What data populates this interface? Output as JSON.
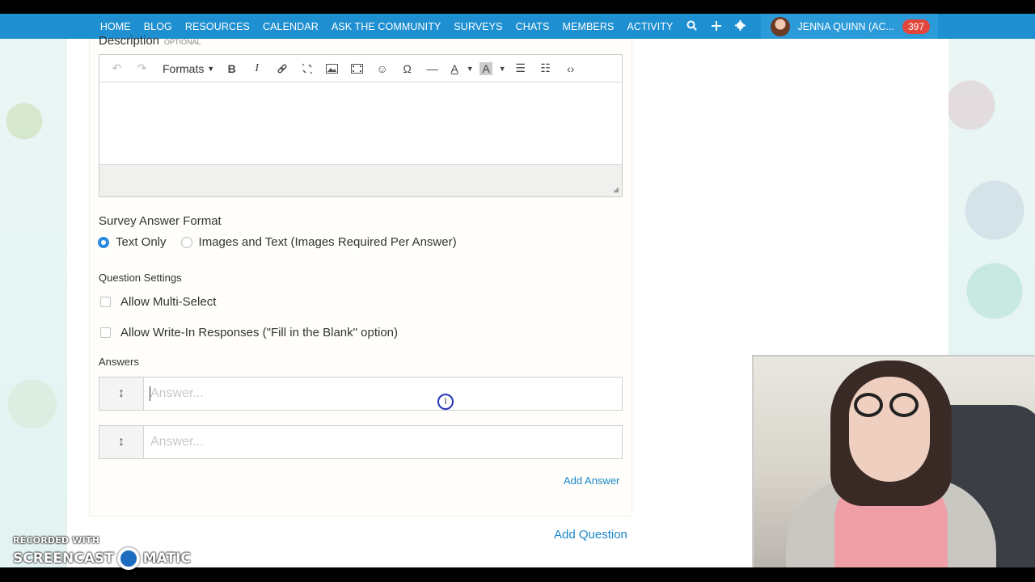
{
  "nav": {
    "items": [
      "HOME",
      "BLOG",
      "RESOURCES",
      "CALENDAR",
      "ASK THE COMMUNITY",
      "SURVEYS",
      "CHATS",
      "MEMBERS",
      "ACTIVITY"
    ],
    "user_name": "JENNA QUINN (AC...",
    "notification_count": "397"
  },
  "description": {
    "label": "Description",
    "optional_tag": "OPTIONAL"
  },
  "editor": {
    "formats_label": "Formats"
  },
  "answer_format": {
    "title": "Survey Answer Format",
    "options": [
      "Text Only",
      "Images and Text (Images Required Per Answer)"
    ],
    "selected": "Text Only"
  },
  "question_settings": {
    "title": "Question Settings",
    "multi_select_label": "Allow Multi-Select",
    "write_in_label": "Allow Write-In Responses (\"Fill in the Blank\" option)"
  },
  "answers": {
    "title": "Answers",
    "placeholder": "Answer...",
    "add_answer": "Add Answer"
  },
  "add_question": "Add Question",
  "watermark": {
    "recorded_with": "RECORDED WITH",
    "brand_left": "SCREENCAST",
    "brand_right": "MATIC"
  }
}
